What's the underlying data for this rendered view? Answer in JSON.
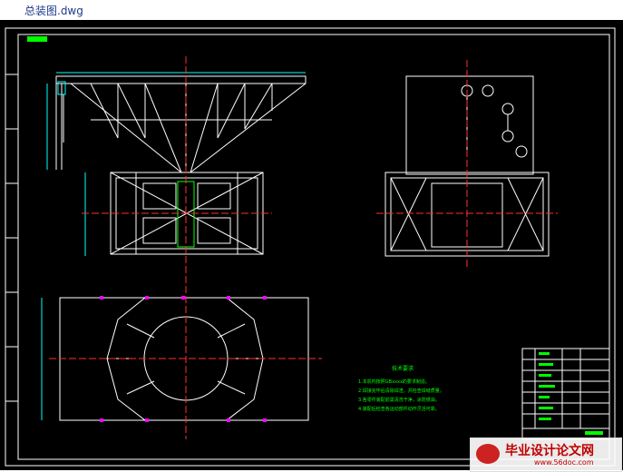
{
  "window": {
    "title": "总装图.dwg"
  },
  "drawing": {
    "notes_title": "技术要求",
    "notes": [
      "1.本机构按照GBxxxx的要求制造。",
      "2.焊接完毕后清除焊渣，并检查焊缝质量。",
      "3.各零件装配前需清洗干净，涂防锈油。",
      "4.装配后检查各运动部件动作灵活可靠。"
    ],
    "watermark": {
      "text": "毕业设计论文网",
      "url": "www.56doc.com"
    }
  },
  "colors": {
    "background": "#000000",
    "frame": "#ffffff",
    "geometry": "#ffffff",
    "centerline": "#ff3030",
    "dimension": "#00ffff",
    "parts": "#00ff00",
    "accent": "#ff00ff"
  }
}
